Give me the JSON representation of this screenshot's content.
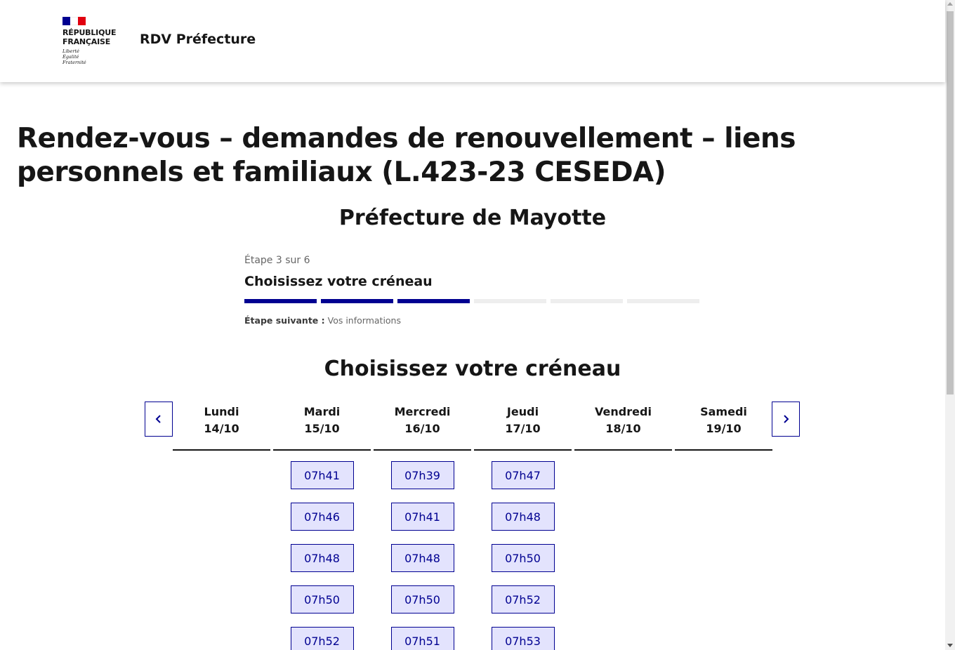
{
  "header": {
    "logo": {
      "republique": "RÉPUBLIQUE\nFRANÇAISE",
      "motto": "Liberté\nÉgalité\nFraternité"
    },
    "service_name": "RDV Préfecture"
  },
  "page": {
    "title": "Rendez-vous – demandes de renouvellement – liens personnels et familiaux (L.423-23 CESEDA)",
    "prefecture": "Préfecture de Mayotte"
  },
  "stepper": {
    "count": "Étape 3 sur 6",
    "title": "Choisissez votre créneau",
    "current_step": 3,
    "total_steps": 6,
    "next_label": "Étape suivante :",
    "next_value": "Vos informations"
  },
  "calendar": {
    "title": "Choisissez votre créneau",
    "prev_icon": "chevron-left-icon",
    "next_icon": "chevron-right-icon",
    "days": [
      {
        "name": "Lundi",
        "date": "14/10",
        "slots": []
      },
      {
        "name": "Mardi",
        "date": "15/10",
        "slots": [
          "07h41",
          "07h46",
          "07h48",
          "07h50",
          "07h52"
        ]
      },
      {
        "name": "Mercredi",
        "date": "16/10",
        "slots": [
          "07h39",
          "07h41",
          "07h48",
          "07h50",
          "07h51"
        ]
      },
      {
        "name": "Jeudi",
        "date": "17/10",
        "slots": [
          "07h47",
          "07h48",
          "07h50",
          "07h52",
          "07h53"
        ]
      },
      {
        "name": "Vendredi",
        "date": "18/10",
        "slots": []
      },
      {
        "name": "Samedi",
        "date": "19/10",
        "slots": []
      }
    ]
  },
  "colors": {
    "primary_blue": "#000091",
    "slot_bg": "#e3e3fd",
    "flag_red": "#e1000f",
    "text": "#161616"
  }
}
